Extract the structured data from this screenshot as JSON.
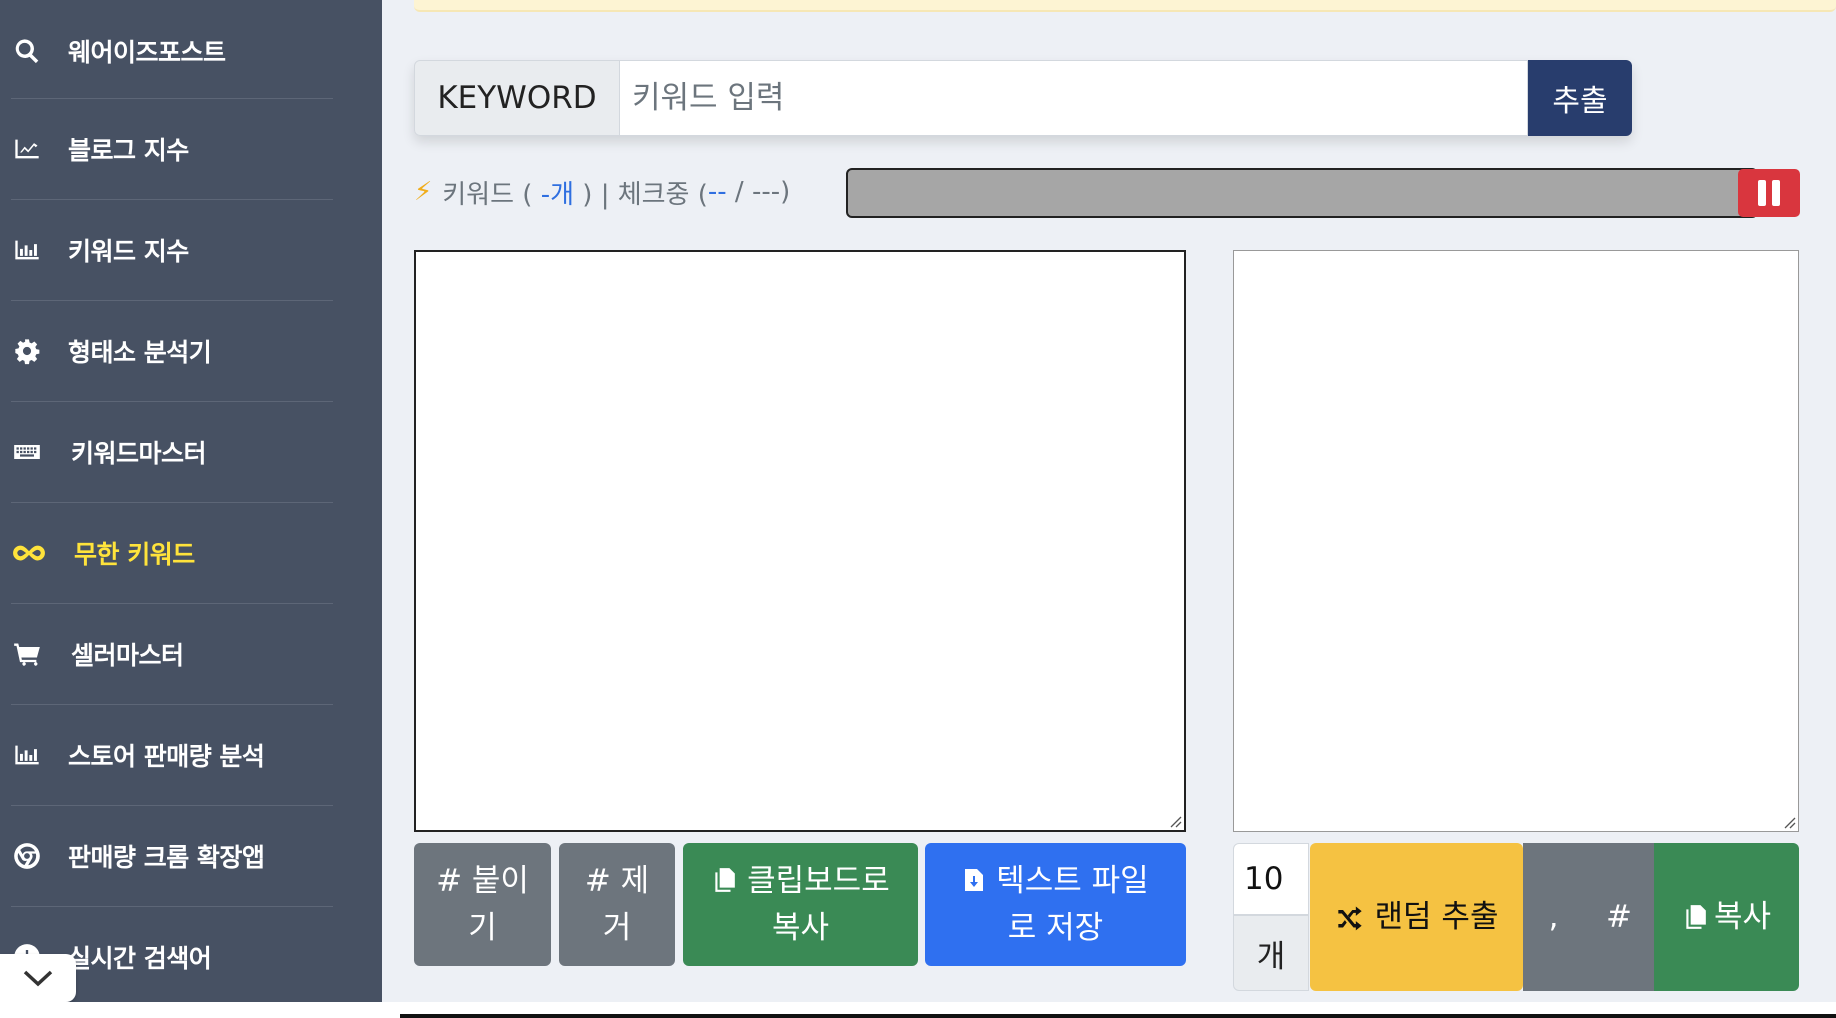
{
  "sidebar": {
    "items": [
      {
        "label": "웨어이즈포스트",
        "icon": "search-icon",
        "active": false
      },
      {
        "label": "블로그 지수",
        "icon": "line-chart-icon",
        "active": false
      },
      {
        "label": "키워드 지수",
        "icon": "bar-chart-icon",
        "active": false
      },
      {
        "label": "형태소 분석기",
        "icon": "gear-icon",
        "active": false
      },
      {
        "label": "키워드마스터",
        "icon": "keyboard-icon",
        "active": false
      },
      {
        "label": "무한 키워드",
        "icon": "infinity-icon",
        "active": true
      },
      {
        "label": "셀러마스터",
        "icon": "cart-icon",
        "active": false
      },
      {
        "label": "스토어 판매량 분석",
        "icon": "bar-chart-icon",
        "active": false
      },
      {
        "label": "판매량 크롬 확장앱",
        "icon": "chrome-icon",
        "active": false
      },
      {
        "label": "실시간 검색어",
        "icon": "clock-icon",
        "active": false
      }
    ]
  },
  "search": {
    "prefix": "KEYWORD",
    "placeholder": "키워드 입력",
    "value": "",
    "button_label": "추출"
  },
  "status": {
    "keyword_label": "키워드 (",
    "keyword_count": "-개",
    "middle": ") | 체크중 (",
    "checked": "--",
    "slash": "/",
    "total": "---",
    "close": ")"
  },
  "progress": {
    "percent": 100
  },
  "left_actions": {
    "attach_hash": "# 붙이기",
    "remove_hash": "# 제거",
    "copy_clipboard": "클립보드로 복사",
    "save_text": "텍스트 파일로 저장"
  },
  "right_actions": {
    "count_value": "10",
    "count_unit": "개",
    "random_extract": "랜덤 추출",
    "comma": ",",
    "hash": "#",
    "copy": "복사"
  },
  "colors": {
    "sidebar_bg": "#475163",
    "active": "#ffe33b",
    "primary_dark": "#283d6d",
    "danger": "#d9363e",
    "success": "#3a8a55",
    "blue": "#2f70f0",
    "warning": "#f5c242",
    "secondary": "#6d757d"
  }
}
